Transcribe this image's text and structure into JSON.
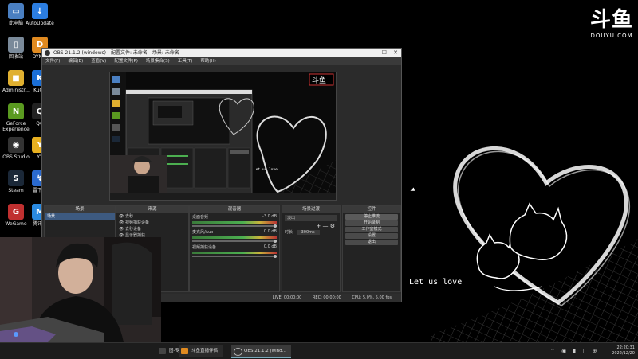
{
  "watermark": {
    "logo": "斗鱼",
    "site": "DOUYU.COM"
  },
  "desktop_icons": [
    {
      "label": "此电脑",
      "color": "#4a7fc1",
      "glyph": "▭"
    },
    {
      "label": "AutoUpdate",
      "color": "#2b7de0",
      "glyph": "↓"
    },
    {
      "label": "回收站",
      "color": "#7a8a9a",
      "glyph": "▯"
    },
    {
      "label": "DYM...",
      "color": "#e08a20",
      "glyph": "D"
    },
    {
      "label": "Administr...",
      "color": "#e0b030",
      "glyph": "■"
    },
    {
      "label": "KuGo",
      "color": "#1a6fd8",
      "glyph": "K"
    },
    {
      "label": "GeForce Experience",
      "color": "#5a9a20",
      "glyph": "N"
    },
    {
      "label": "QQ",
      "color": "#222222",
      "glyph": "Q"
    },
    {
      "label": "OBS Studio",
      "color": "#333333",
      "glyph": "◉"
    },
    {
      "label": "YY",
      "color": "#e8b020",
      "glyph": "Y"
    },
    {
      "label": "Steam",
      "color": "#1b2838",
      "glyph": "S"
    },
    {
      "label": "雷下载",
      "color": "#2a6ad0",
      "glyph": "↯"
    },
    {
      "label": "WeGame",
      "color": "#c03030",
      "glyph": "G"
    },
    {
      "label": "腾讯会",
      "color": "#2a8ae0",
      "glyph": "M"
    }
  ],
  "obs": {
    "title": "OBS 21.1.2 (windows) - 配置文件: 未命名 - 场景: 未命名",
    "window_controls": {
      "minimize": "—",
      "maximize": "☐",
      "close": "✕"
    },
    "menu": [
      "文件(F)",
      "编辑(E)",
      "查看(V)",
      "配置文件(P)",
      "场景集合(S)",
      "工具(T)",
      "帮助(H)"
    ],
    "preview_text": "Let us love",
    "docks": {
      "scenes": {
        "title": "场景",
        "items": [
          "场景"
        ]
      },
      "sources": {
        "title": "来源",
        "items": [
          "去秒",
          "视频捕获设备",
          "去秒设备",
          "显示器捕获"
        ]
      },
      "mixer": {
        "title": "混音器",
        "channels": [
          {
            "name": "桌面音频",
            "db": "-3.0 dB"
          },
          {
            "name": "麦克风/Aux",
            "db": "0.0 dB"
          },
          {
            "name": "视频捕获设备",
            "db": "0.0 dB"
          }
        ]
      },
      "transitions": {
        "title": "场景过渡",
        "type": "淡出",
        "duration_label": "时长",
        "duration": "300ms",
        "add": "+",
        "remove": "—"
      },
      "controls": {
        "title": "控件",
        "buttons": [
          "停止推流",
          "开始录制",
          "工作室模式",
          "设置",
          "退出"
        ]
      }
    },
    "status": {
      "live": "LIVE: 00:00:00",
      "rec": "REC: 00:00:00",
      "cpu": "CPU: 5.0%, 5.00 fps"
    }
  },
  "desktop_wallpaper_text": "Let us love",
  "taskbar": {
    "tasks": [
      {
        "label": "图-专...",
        "color": "#444444"
      },
      {
        "label": "斗鱼直播伴侣",
        "color": "#e08a20"
      },
      {
        "label": "OBS 21.1.2 (wind...",
        "color": "#333333"
      }
    ],
    "time": "22:20:31",
    "date": "2022/12/20"
  }
}
